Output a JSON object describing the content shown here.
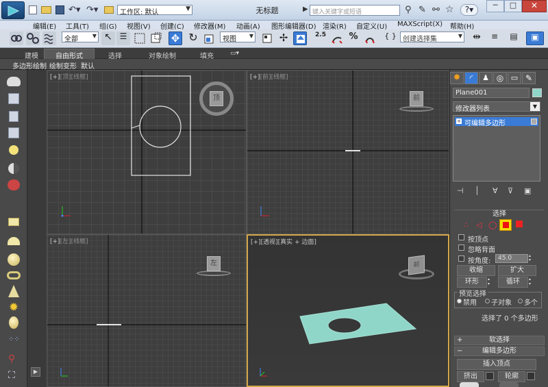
{
  "window": {
    "title": "无标题",
    "workspace_label": "工作区: 默认",
    "search_placeholder": "键入关键字或短语"
  },
  "menu": {
    "items": [
      "编辑(E)",
      "工具(T)",
      "组(G)",
      "视图(V)",
      "创建(C)",
      "修改器(M)",
      "动画(A)",
      "图形编辑器(D)",
      "渲染(R)",
      "自定义(U)",
      "MAXScript(X)",
      "帮助(H)"
    ]
  },
  "toolbar": {
    "selection_filter": "全部",
    "ref_coord": "视图",
    "snap_value": "2.5",
    "named_selection": "创建选择集"
  },
  "ribbon": {
    "tabs": [
      "建模",
      "自由形式",
      "选择",
      "对象绘制",
      "填充"
    ],
    "active_tab": "自由形式",
    "subtabs": [
      "多边形绘制",
      "绘制变形",
      "默认"
    ]
  },
  "viewports": {
    "top": {
      "bracket": "[+]",
      "view": "[顶]",
      "shade": "[线框]",
      "cube_face": "顶"
    },
    "front": {
      "bracket": "[+]",
      "view": "[前]",
      "shade": "[线框]",
      "cube_face": "前"
    },
    "left": {
      "bracket": "[+]",
      "view": "[左]",
      "shade": "[线框]",
      "cube_face": "左"
    },
    "persp": {
      "bracket": "[+]",
      "view": "[透视]",
      "shade": "[真实 + 边面]",
      "cube_face": "前"
    }
  },
  "command_panel": {
    "object_name": "Plane001",
    "modifier_list": "修改器列表",
    "stack_item": "可编辑多边形",
    "selection": {
      "header": "选择",
      "by_vertex": "按顶点",
      "ignore_backfacing": "忽略背面",
      "by_angle": "按角度:",
      "angle_value": "45.0",
      "shrink": "收缩",
      "grow": "扩大",
      "ring": "环形",
      "loop": "循环",
      "preview_label": "预览选择",
      "preview_options": [
        "禁用",
        "子对象",
        "多个"
      ],
      "status": "选择了 0 个多边形"
    },
    "soft_selection": "软选择",
    "edit_polygons": {
      "header": "编辑多边形",
      "insert_vertex": "插入顶点",
      "extrude": "挤出",
      "outline": "轮廓"
    }
  },
  "colors": {
    "accent_blue": "#3a7bd5",
    "plane_fill": "#8fd6c9",
    "wireframe": "#e6e6e6",
    "active_viewport_border": "#d4a74a"
  }
}
